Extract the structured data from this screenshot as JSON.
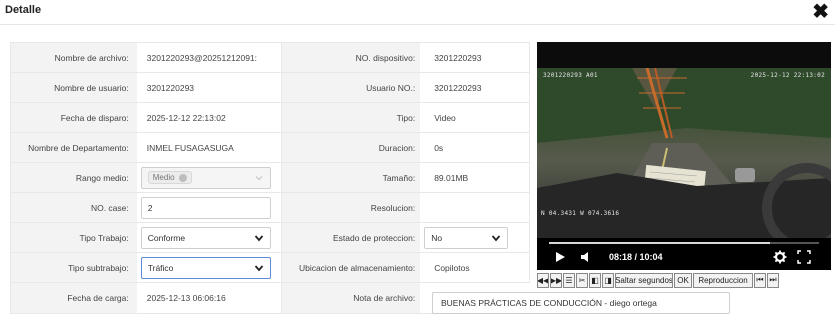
{
  "dialog": {
    "title": "Detalle",
    "close_icon": "close-icon"
  },
  "fields": {
    "file_name_label": "Nombre de archivo:",
    "file_name": "3201220293@20251212091:",
    "device_no_label": "NO. dispositivo:",
    "device_no": "3201220293",
    "user_name_label": "Nombre de usuario:",
    "user_name": "3201220293",
    "user_no_label": "Usuario NO.:",
    "user_no": "3201220293",
    "trigger_date_label": "Fecha de disparo:",
    "trigger_date": "2025-12-12 22:13:02",
    "type_label": "Tipo:",
    "type": "Video",
    "department_label": "Nombre de Departamento:",
    "department": "INMEL FUSAGASUGA",
    "duration_label": "Duracion:",
    "duration": "0s",
    "medium_range_label": "Rango medio:",
    "medium_range_tag": "Medio",
    "size_label": "Tamaño:",
    "size": "89.01MB",
    "case_no_label": "NO. case:",
    "case_no": "2",
    "resolution_label": "Resolucion:",
    "resolution": "",
    "work_type_label": "Tipo Trabajo:",
    "work_type": "Conforme",
    "protection_state_label": "Estado de proteccion:",
    "protection_state": "No",
    "work_subtype_label": "Tipo subtrabajo:",
    "work_subtype": "Tráfico",
    "storage_location_label": "Ubicacion de almacenamiento:",
    "storage_location": "Copilotos",
    "upload_date_label": "Fecha de carga:",
    "upload_date": "2025-12-13 06:06:16",
    "file_note_label": "Nota de archivo:",
    "file_note": "BUENAS PRÁCTICAS DE CONDUCCIÓN - diego ortega"
  },
  "video": {
    "osd_top_left": "3201220293 A01",
    "osd_top_right": "2025-12-12 22:13:02",
    "osd_bottom_left": "N 04.3431 W 074.3616",
    "time_display": "08:18 / 10:04",
    "progress": 0.82,
    "icons": [
      "play-icon",
      "volume-icon",
      "settings-icon",
      "fullscreen-icon"
    ]
  },
  "toolbar": {
    "skip_label": "Saltar segundos",
    "ok_label": "OK",
    "playback_label": "Reproduccion"
  },
  "colors": {
    "focus_border": "#5b8bd8",
    "label_bg": "#f3f3f3"
  }
}
